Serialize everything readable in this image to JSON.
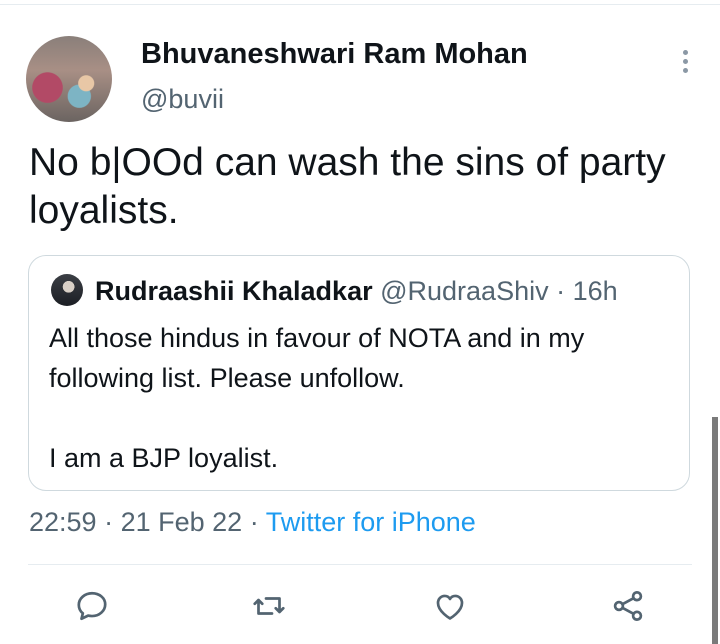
{
  "tweet": {
    "display_name": "Bhuvaneshwari Ram Mohan",
    "handle": "@buvii",
    "text": "No b|OOd can wash the sins of party loyalists.",
    "time": "22:59",
    "separator": "·",
    "date": "21 Feb 22",
    "source": "Twitter for iPhone"
  },
  "quoted": {
    "display_name": "Rudraashii Khaladkar",
    "handle": "@RudraaShiv",
    "separator": "·",
    "age": "16h",
    "text": "All those hindus in favour of NOTA and in my following list. Please unfollow.\n\nI am a BJP loyalist."
  },
  "actions": [
    {
      "icon": "reply-icon"
    },
    {
      "icon": "retweet-icon"
    },
    {
      "icon": "like-icon"
    },
    {
      "icon": "share-icon"
    }
  ],
  "colors": {
    "text": "#0f1419",
    "secondary": "#536471",
    "link": "#1d9bf0",
    "border": "#cfd9de"
  }
}
